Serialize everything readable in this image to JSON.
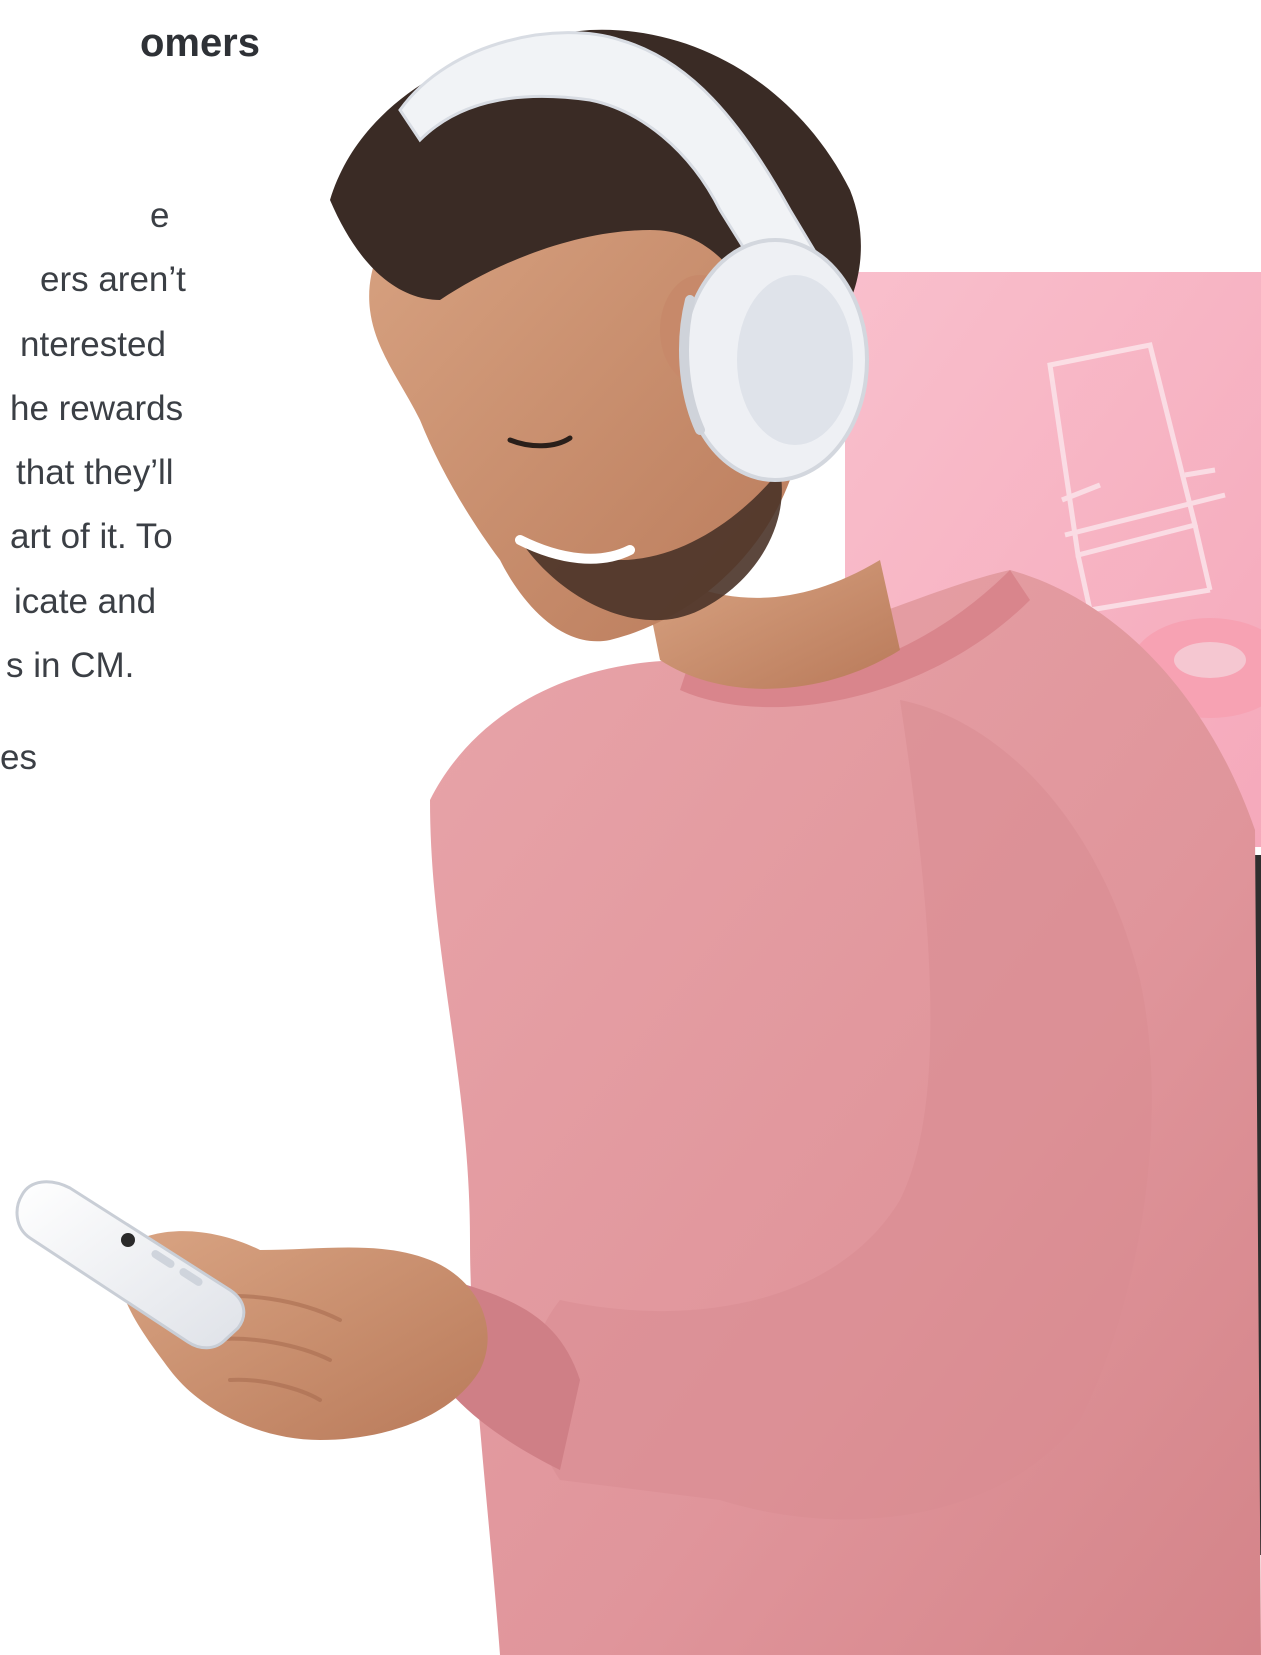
{
  "article": {
    "heading": "omers",
    "body_lines": [
      "e",
      "ers aren’t",
      "nterested",
      "he rewards",
      "that they’ll",
      "art of it. To",
      "icate and",
      "s in CM.",
      "es"
    ]
  },
  "image": {
    "alt": "Man with white headphones and pink sweater looking at phone, pink backdrop with chair",
    "colors": {
      "backdrop_pink": "#f8b9c8",
      "sweater_pink": "#e39aa0",
      "headphones": "#eef0f4",
      "hair": "#3a2b25",
      "skin": "#c98c6a",
      "dark_panel": "#2f2f2f"
    }
  }
}
